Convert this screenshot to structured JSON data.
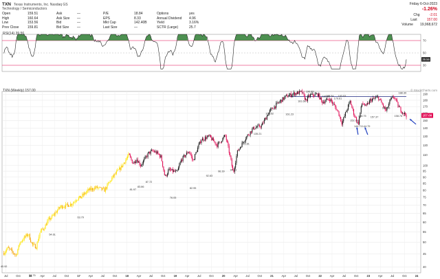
{
  "header": {
    "symbol": "TXN",
    "company": "Texas Instruments, Inc.  Nasdaq GS",
    "sector": "Technology / Semiconductors",
    "quotes": [
      [
        "Open",
        "159.51"
      ],
      [
        "High",
        "160.64"
      ],
      [
        "Low",
        "153.56"
      ],
      [
        "Prev Close",
        "159.81"
      ],
      [
        "Ask",
        "—"
      ],
      [
        "Ask Size",
        "—"
      ],
      [
        "Bid",
        "—"
      ],
      [
        "Bid Size",
        "—"
      ],
      [
        "P/E",
        "18.84"
      ],
      [
        "EPS",
        "8.33"
      ],
      [
        "Mkt Cap",
        "142.40B"
      ],
      [
        "Last Size",
        "—"
      ],
      [
        "Options",
        "yes"
      ],
      [
        "Annual Dividend",
        "4.96"
      ],
      [
        "Yield",
        "3.16%"
      ],
      [
        "SCTR (Large)",
        "25.7"
      ]
    ],
    "date": "Friday  6-Oct-2023",
    "change_pct": "-1.26%",
    "chg_label": "Chg",
    "chg": "-2.01",
    "last_label": "Last",
    "last": "157.00",
    "volume_label": "Volume",
    "volume": "19,968,672"
  },
  "rsi_label": "RSI(14) 39.56",
  "price_label": "TXN (Weekly) 157.00",
  "brand": "© StockCharts.com",
  "chart_data": {
    "type": "line",
    "subtype": "weekly-candlestick",
    "title": "TXN (Weekly) 157.00",
    "x_ticks": [
      "Jul",
      "Oct",
      "16",
      "Apr",
      "Jul",
      "Oct",
      "17",
      "Apr",
      "Jul",
      "Oct",
      "18",
      "Apr",
      "Jul",
      "Oct",
      "19",
      "Apr",
      "Jul",
      "Oct",
      "20",
      "Apr",
      "Jul",
      "Oct",
      "21",
      "Apr",
      "Jul",
      "Oct",
      "22",
      "Apr",
      "Jul",
      "Oct",
      "23",
      "Apr",
      "Jul",
      "Oct",
      "24"
    ],
    "y_ticks": [
      40,
      45,
      50,
      55,
      60,
      65,
      70,
      75,
      80,
      85,
      90,
      95,
      100,
      110,
      120,
      130,
      140,
      150,
      160,
      170,
      180,
      190
    ],
    "ylim": [
      38,
      195
    ],
    "y_scale": "log",
    "price_path": [
      [
        "2015-06",
        45.5
      ],
      [
        "2015-07",
        47.5
      ],
      [
        "2015-09",
        44.5
      ],
      [
        "2015-10",
        50
      ],
      [
        "2015-12",
        54
      ],
      [
        "2016-01",
        49
      ],
      [
        "2016-02",
        48
      ],
      [
        "2016-03",
        55
      ],
      [
        "2016-04",
        57
      ],
      [
        "2016-05",
        61
      ],
      [
        "2016-06",
        63
      ],
      [
        "2016-08",
        69
      ],
      [
        "2016-10",
        70
      ],
      [
        "2016-11",
        71
      ],
      [
        "2016-12",
        74
      ],
      [
        "2017-01",
        75
      ],
      [
        "2017-03",
        80
      ],
      [
        "2017-05",
        82
      ],
      [
        "2017-07",
        80
      ],
      [
        "2017-09",
        90
      ],
      [
        "2017-11",
        98
      ],
      [
        "2018-01",
        110
      ],
      [
        "2018-02",
        102
      ],
      [
        "2018-03",
        106
      ],
      [
        "2018-04",
        100
      ],
      [
        "2018-06",
        112
      ],
      [
        "2018-07",
        114
      ],
      [
        "2018-08",
        112
      ],
      [
        "2018-09",
        108
      ],
      [
        "2018-10",
        90
      ],
      [
        "2018-11",
        96
      ],
      [
        "2019-01",
        94
      ],
      [
        "2019-02",
        105
      ],
      [
        "2019-04",
        114
      ],
      [
        "2019-05",
        104
      ],
      [
        "2019-07",
        126
      ],
      [
        "2019-09",
        130
      ],
      [
        "2019-11",
        120
      ],
      [
        "2020-01",
        131
      ],
      [
        "2020-03",
        93
      ],
      [
        "2020-04",
        113
      ],
      [
        "2020-06",
        128
      ],
      [
        "2020-08",
        140
      ],
      [
        "2020-10",
        143
      ],
      [
        "2020-12",
        163
      ],
      [
        "2021-02",
        175
      ],
      [
        "2021-04",
        186
      ],
      [
        "2021-06",
        191
      ],
      [
        "2021-08",
        194
      ],
      [
        "2021-09",
        180
      ],
      [
        "2021-10",
        188
      ],
      [
        "2021-12",
        190
      ],
      [
        "2022-01",
        177
      ],
      [
        "2022-03",
        182
      ],
      [
        "2022-05",
        163
      ],
      [
        "2022-06",
        146
      ],
      [
        "2022-08",
        178
      ],
      [
        "2022-09",
        158
      ],
      [
        "2022-10",
        145
      ],
      [
        "2022-11",
        176
      ],
      [
        "2022-12",
        170
      ],
      [
        "2023-01",
        180
      ],
      [
        "2023-03",
        185
      ],
      [
        "2023-05",
        163
      ],
      [
        "2023-06",
        180
      ],
      [
        "2023-07",
        186
      ],
      [
        "2023-08",
        170
      ],
      [
        "2023-09",
        162
      ],
      [
        "2023-10",
        157
      ]
    ],
    "resistance_line": 186,
    "price_annotations": [
      [
        "2015-06",
        40.92
      ],
      [
        "2016-01",
        37.75
      ],
      [
        "2016-06",
        54.61
      ],
      [
        "2017-01",
        63.79
      ],
      [
        "2018-02",
        81.97
      ],
      [
        "2018-04",
        83.86
      ],
      [
        "2018-06",
        87.72
      ],
      [
        "2018-12",
        76.05
      ],
      [
        "2019-05",
        82.95
      ],
      [
        "2019-09",
        92.63
      ],
      [
        "2019-12",
        96.39
      ],
      [
        "2020-03",
        94.13
      ],
      [
        "2020-06",
        123.81
      ],
      [
        "2020-09",
        135.21
      ],
      [
        "2020-12",
        162.52
      ],
      [
        "2021-05",
        161.23
      ],
      [
        "2021-08",
        181.68
      ],
      [
        "2021-10",
        190.89
      ],
      [
        "2022-02",
        182.82
      ],
      [
        "2022-03",
        183.54
      ],
      [
        "2022-05",
        179.61
      ],
      [
        "2022-06",
        183.53
      ],
      [
        "2022-09",
        152.74
      ],
      [
        "2022-10",
        144.71
      ],
      [
        "2022-11",
        158.75
      ],
      [
        "2022-12",
        144.79
      ],
      [
        "2023-02",
        157.37
      ],
      [
        "2023-05",
        164.26
      ],
      [
        "2023-08",
        158.76
      ],
      [
        "2023-09",
        188.39
      ]
    ],
    "last_price_tag": 157.0,
    "rsi": {
      "label": "RSI(14) 39.56",
      "ylim": [
        20,
        80
      ],
      "levels": [
        30,
        50,
        70
      ],
      "tick_labels": [
        "30",
        "50",
        "70"
      ],
      "latest": 39.56
    }
  }
}
